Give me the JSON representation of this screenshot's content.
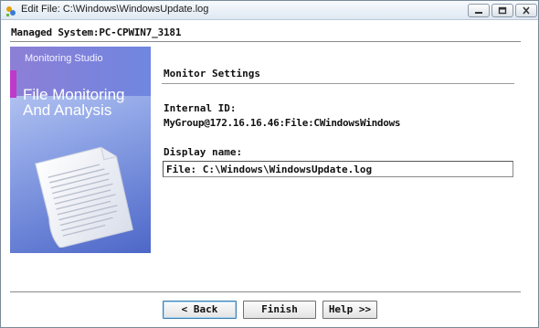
{
  "window": {
    "title": "Edit File: C:\\Windows\\WindowsUpdate.log",
    "controls": [
      "minimize",
      "maximize",
      "close"
    ]
  },
  "header": {
    "managed_system": "Managed System:PC-CPWIN7_3181"
  },
  "banner": {
    "brand": "Monitoring Studio",
    "heading_line1": "File Monitoring",
    "heading_line2": "And Analysis"
  },
  "settings": {
    "section_title": "Monitor Settings",
    "internal_id_label": "Internal ID:",
    "internal_id_value": "MyGroup@172.16.16.46:File:CWindowsWindows",
    "display_name_label": "Display name:",
    "display_name_value": "File: C:\\Windows\\WindowsUpdate.log"
  },
  "buttons": {
    "back": "< Back",
    "finish": "Finish",
    "help": "Help >>"
  },
  "colors": {
    "banner_top": "#8d7fd6",
    "banner_bottom": "#4d67c8",
    "banner_accent": "#c03ac9",
    "default_button_border": "#3c7fb1"
  }
}
